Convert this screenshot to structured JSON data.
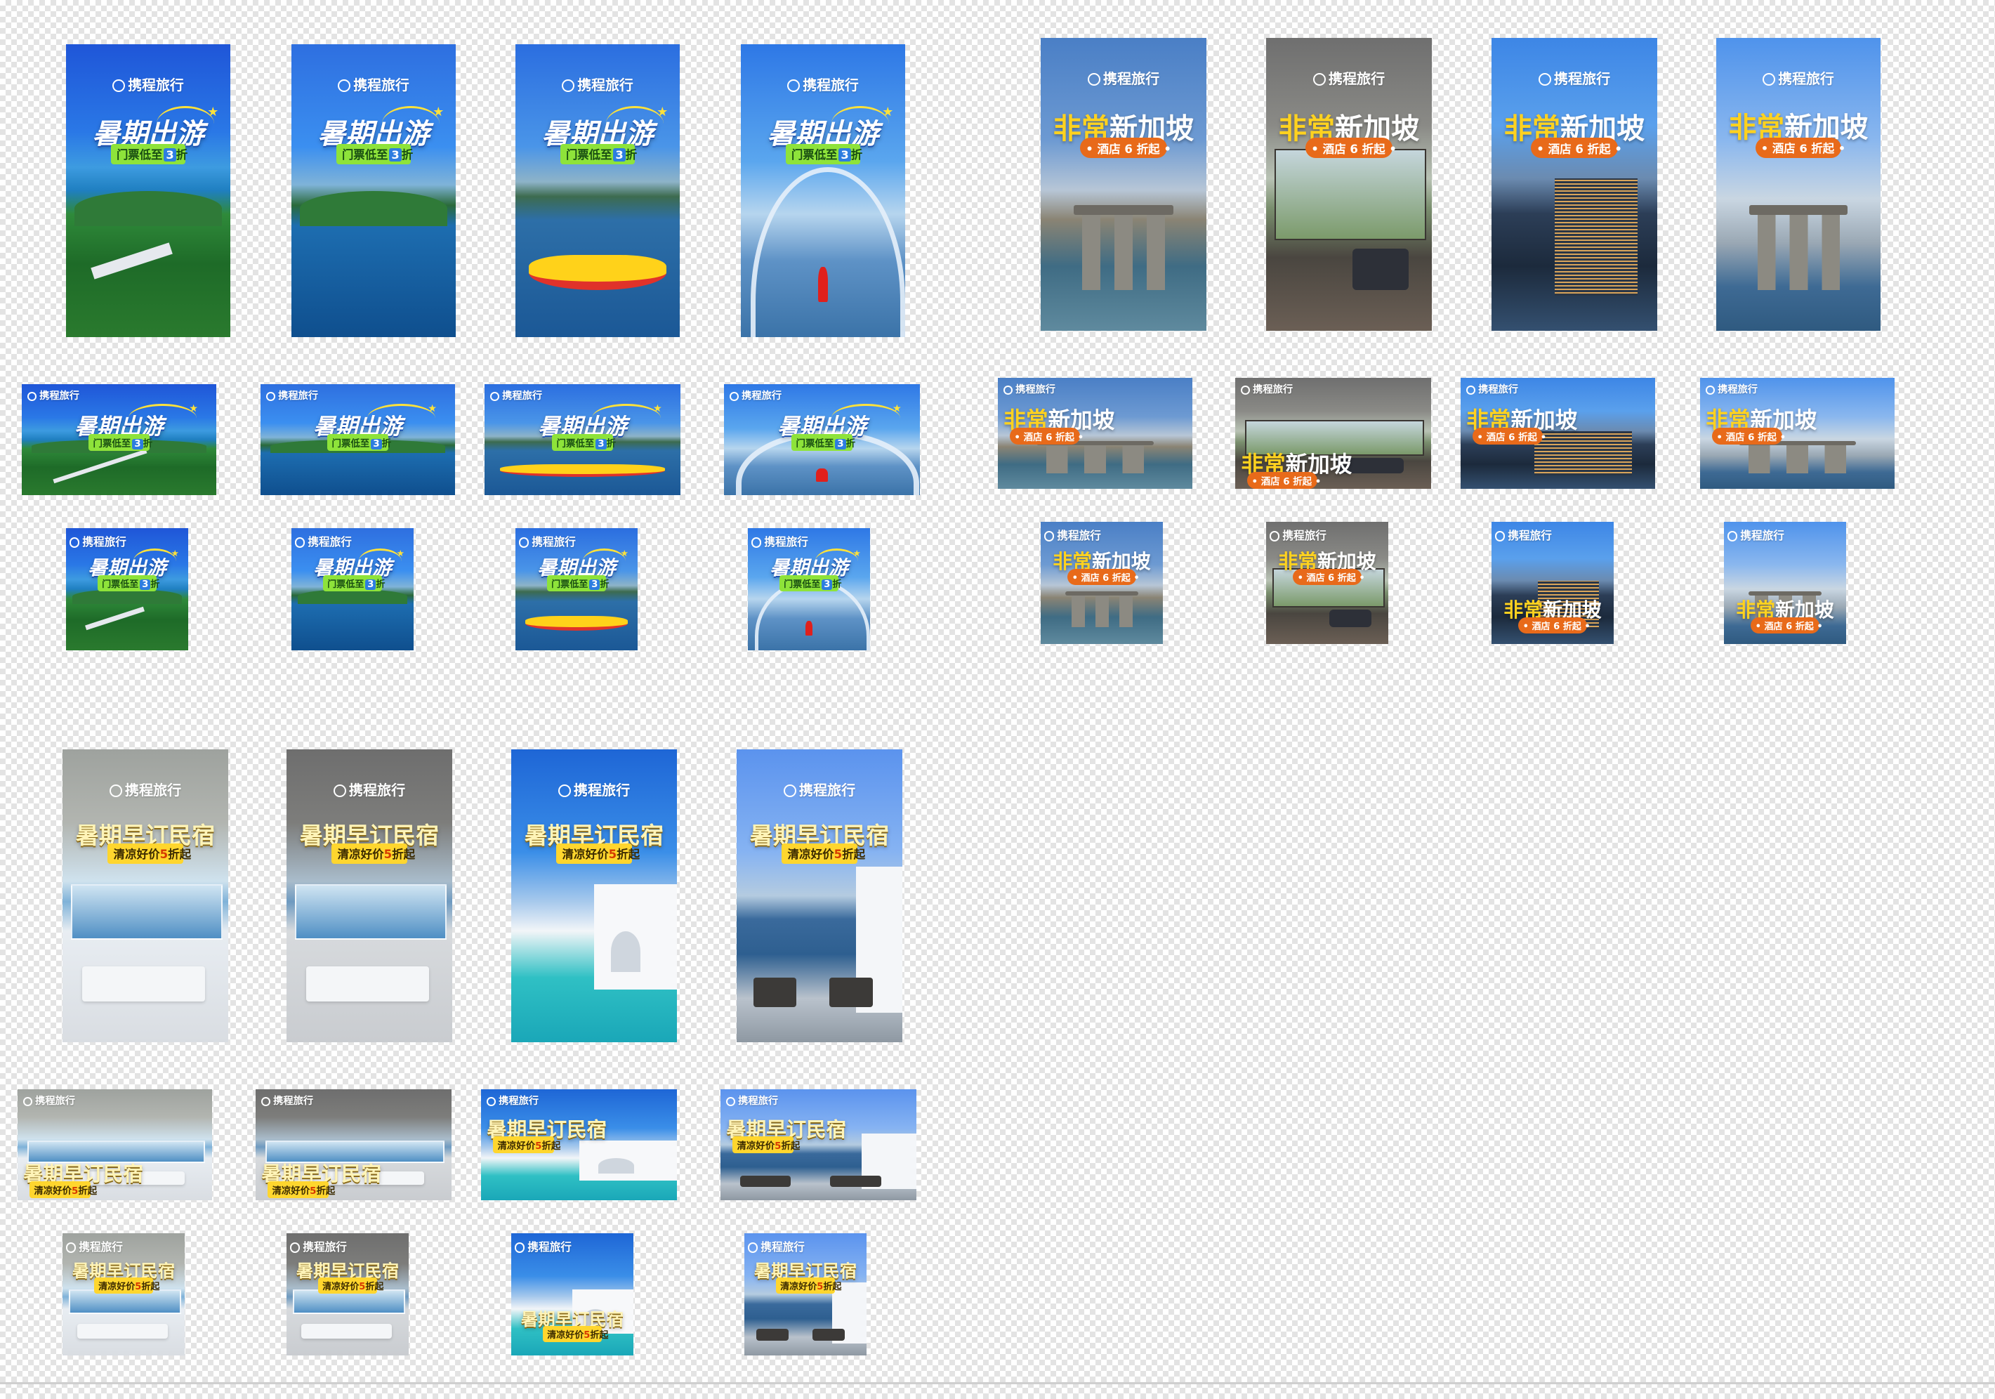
{
  "brand": "携程旅行",
  "campaigns": {
    "summer_trip": {
      "title": "暑期出游",
      "subtitle": "门票低至",
      "discount_num": "3",
      "discount_unit": "折"
    },
    "singapore": {
      "title_hl": "非常",
      "title_rest": "新加坡",
      "subtitle": "• 酒店 6 折起 •"
    },
    "homestay": {
      "title": "暑期早订民宿",
      "subtitle": "清凉好价",
      "discount_num": "5",
      "discount_unit": "折起"
    }
  },
  "colors": {
    "brand_blue": "#1f56d8",
    "highlight_yellow": "#ffd21f",
    "badge_green": "#8ee33a",
    "badge_orange": "#e86a1a",
    "badge_yellow": "#ffd62e",
    "checker_light": "#ffffff",
    "checker_dark": "#e3e3e3"
  },
  "icons": [
    "ctrip-logo-icon",
    "star-icon"
  ]
}
